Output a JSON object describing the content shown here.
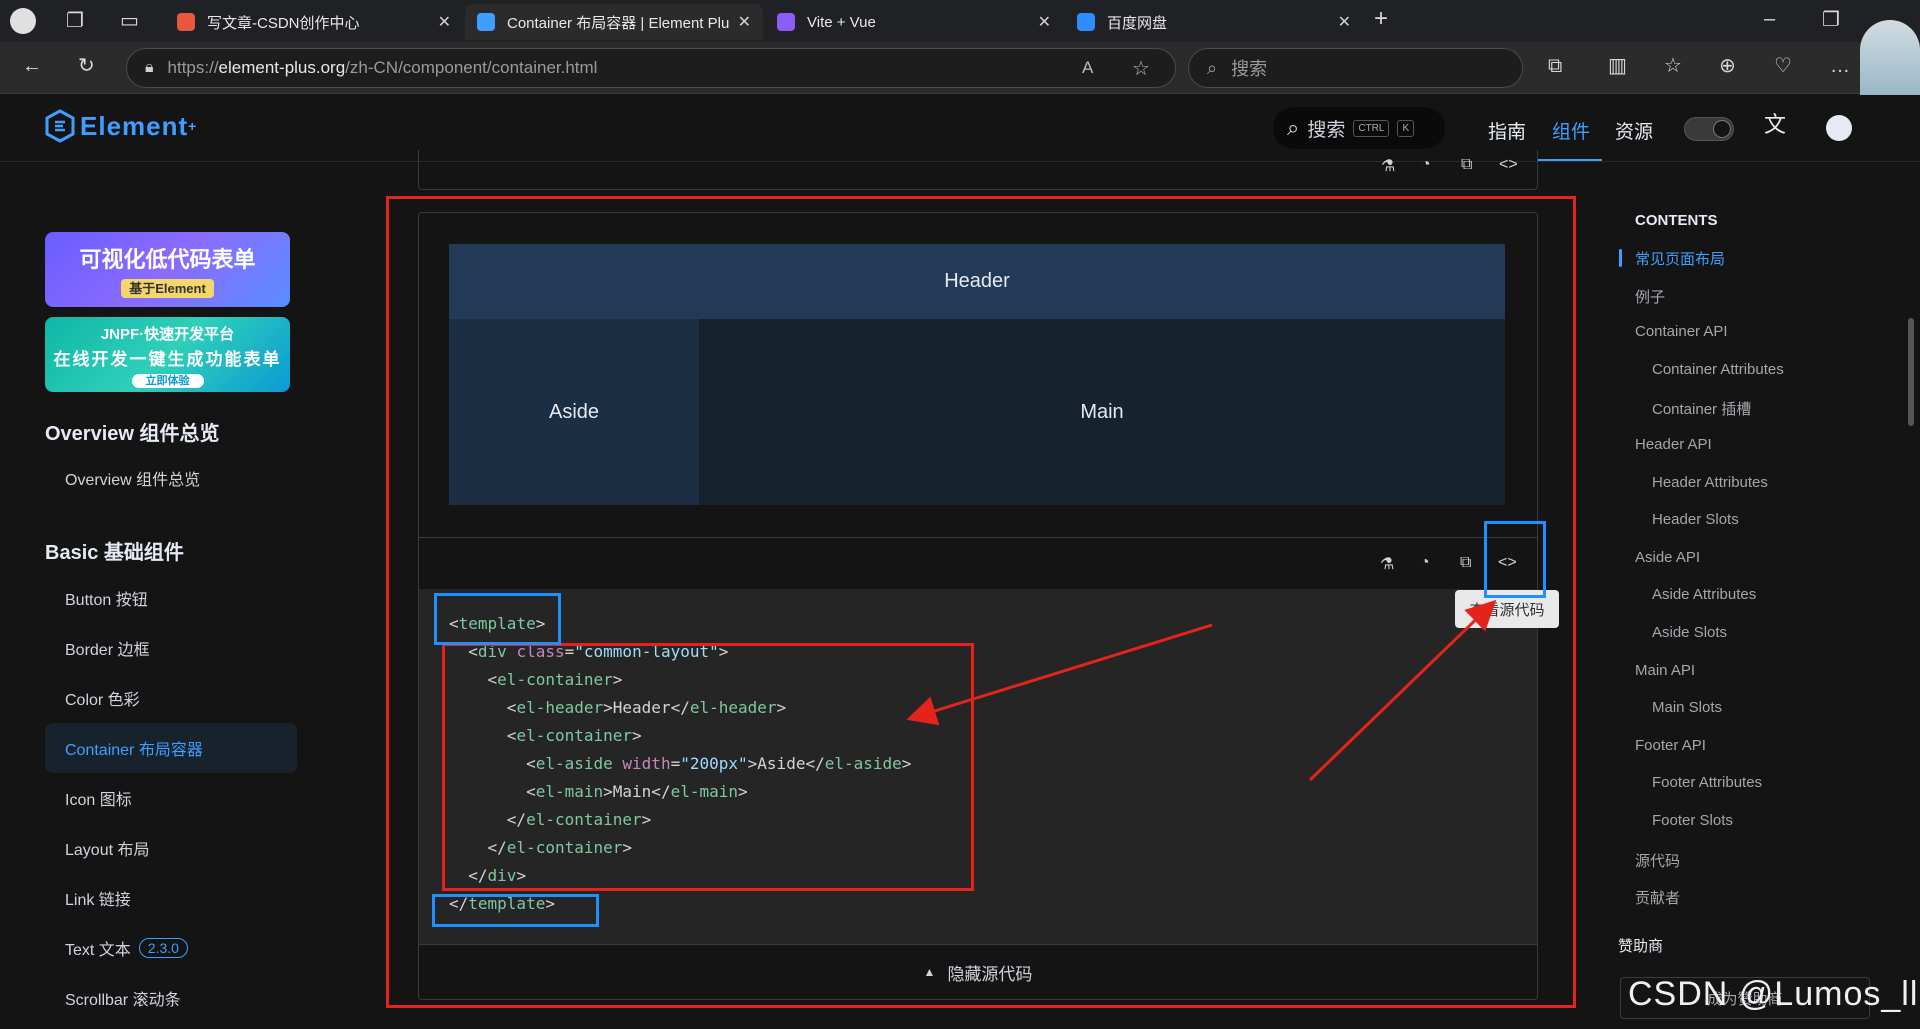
{
  "browser": {
    "tabs": [
      {
        "label": "写文章-CSDN创作中心",
        "active": false,
        "favicon_color": "#e9573f"
      },
      {
        "label": "Container 布局容器 | Element Plus",
        "active": true,
        "favicon_color": "#409eff"
      },
      {
        "label": "Vite + Vue",
        "active": false,
        "favicon_color": "#8b5cf6"
      },
      {
        "label": "百度网盘",
        "active": false,
        "favicon_color": "#2f8cff"
      }
    ],
    "url_prefix": "https://",
    "url_host": "element-plus.org",
    "url_path": "/zh-CN/component/container.html",
    "search_placeholder": "搜索"
  },
  "site": {
    "logo_text": "Element",
    "logo_plus": "+",
    "search_label": "搜索",
    "search_kbd_ctrl": "CTRL",
    "search_kbd_k": "K",
    "nav": [
      "指南",
      "组件",
      "资源"
    ],
    "nav_active_index": 1
  },
  "sidebar": {
    "banner1_title": "可视化低代码表单",
    "banner1_sub": "基于Element",
    "banner2_title": "JNPF·快速开发平台",
    "banner2_line": "在线开发一键生成功能表单",
    "banner2_cta": "立即体验",
    "group_overview": "Overview 组件总览",
    "overview_item": "Overview 组件总览",
    "group_basic": "Basic 基础组件",
    "items": [
      {
        "label": "Button 按钮"
      },
      {
        "label": "Border 边框"
      },
      {
        "label": "Color 色彩"
      },
      {
        "label": "Container 布局容器",
        "active": true
      },
      {
        "label": "Icon 图标"
      },
      {
        "label": "Layout 布局"
      },
      {
        "label": "Link 链接"
      },
      {
        "label": "Text 文本",
        "badge": "2.3.0"
      },
      {
        "label": "Scrollbar 滚动条"
      }
    ]
  },
  "demo": {
    "header": "Header",
    "aside": "Aside",
    "main": "Main",
    "tooltip": "查看源代码",
    "hide_source": "隐藏源代码"
  },
  "code": [
    {
      "indent": "",
      "parts": [
        [
          "br",
          "<"
        ],
        [
          "tag",
          "template"
        ],
        [
          "br",
          ">"
        ]
      ]
    },
    {
      "indent": "  ",
      "parts": [
        [
          "br",
          "<"
        ],
        [
          "tag",
          "div"
        ],
        [
          "br",
          " "
        ],
        [
          "attr",
          "class"
        ],
        [
          "br",
          "="
        ],
        [
          "str",
          "\"common-layout\""
        ],
        [
          "br",
          ">"
        ]
      ]
    },
    {
      "indent": "    ",
      "parts": [
        [
          "br",
          "<"
        ],
        [
          "tag",
          "el-container"
        ],
        [
          "br",
          ">"
        ]
      ]
    },
    {
      "indent": "      ",
      "parts": [
        [
          "br",
          "<"
        ],
        [
          "tag",
          "el-header"
        ],
        [
          "br",
          ">Header</"
        ],
        [
          "tag",
          "el-header"
        ],
        [
          "br",
          ">"
        ]
      ]
    },
    {
      "indent": "      ",
      "parts": [
        [
          "br",
          "<"
        ],
        [
          "tag",
          "el-container"
        ],
        [
          "br",
          ">"
        ]
      ]
    },
    {
      "indent": "        ",
      "parts": [
        [
          "br",
          "<"
        ],
        [
          "tag",
          "el-aside"
        ],
        [
          "br",
          " "
        ],
        [
          "attr",
          "width"
        ],
        [
          "br",
          "="
        ],
        [
          "str",
          "\"200px\""
        ],
        [
          "br",
          ">Aside</"
        ],
        [
          "tag",
          "el-aside"
        ],
        [
          "br",
          ">"
        ]
      ]
    },
    {
      "indent": "        ",
      "parts": [
        [
          "br",
          "<"
        ],
        [
          "tag",
          "el-main"
        ],
        [
          "br",
          ">Main</"
        ],
        [
          "tag",
          "el-main"
        ],
        [
          "br",
          ">"
        ]
      ]
    },
    {
      "indent": "      ",
      "parts": [
        [
          "br",
          "</"
        ],
        [
          "tag",
          "el-container"
        ],
        [
          "br",
          ">"
        ]
      ]
    },
    {
      "indent": "    ",
      "parts": [
        [
          "br",
          "</"
        ],
        [
          "tag",
          "el-container"
        ],
        [
          "br",
          ">"
        ]
      ]
    },
    {
      "indent": "  ",
      "parts": [
        [
          "br",
          "</"
        ],
        [
          "tag",
          "div"
        ],
        [
          "br",
          ">"
        ]
      ]
    },
    {
      "indent": "",
      "parts": [
        [
          "br",
          "</"
        ],
        [
          "tag",
          "template"
        ],
        [
          "br",
          ">"
        ]
      ]
    }
  ],
  "toc": {
    "title": "CONTENTS",
    "items": [
      {
        "label": "常见页面布局",
        "level": 1,
        "active": true
      },
      {
        "label": "例子",
        "level": 1
      },
      {
        "label": "Container API",
        "level": 1
      },
      {
        "label": "Container Attributes",
        "level": 2
      },
      {
        "label": "Container 插槽",
        "level": 2
      },
      {
        "label": "Header API",
        "level": 1
      },
      {
        "label": "Header Attributes",
        "level": 2
      },
      {
        "label": "Header Slots",
        "level": 2
      },
      {
        "label": "Aside API",
        "level": 1
      },
      {
        "label": "Aside Attributes",
        "level": 2
      },
      {
        "label": "Aside Slots",
        "level": 2
      },
      {
        "label": "Main API",
        "level": 1
      },
      {
        "label": "Main Slots",
        "level": 2
      },
      {
        "label": "Footer API",
        "level": 1
      },
      {
        "label": "Footer Attributes",
        "level": 2
      },
      {
        "label": "Footer Slots",
        "level": 2
      },
      {
        "label": "源代码",
        "level": 1
      },
      {
        "label": "贡献者",
        "level": 1
      }
    ],
    "sponsor_title": "赞助商",
    "sponsor_box": "成为赞助商"
  },
  "watermark": "CSDN @Lumos_ll"
}
